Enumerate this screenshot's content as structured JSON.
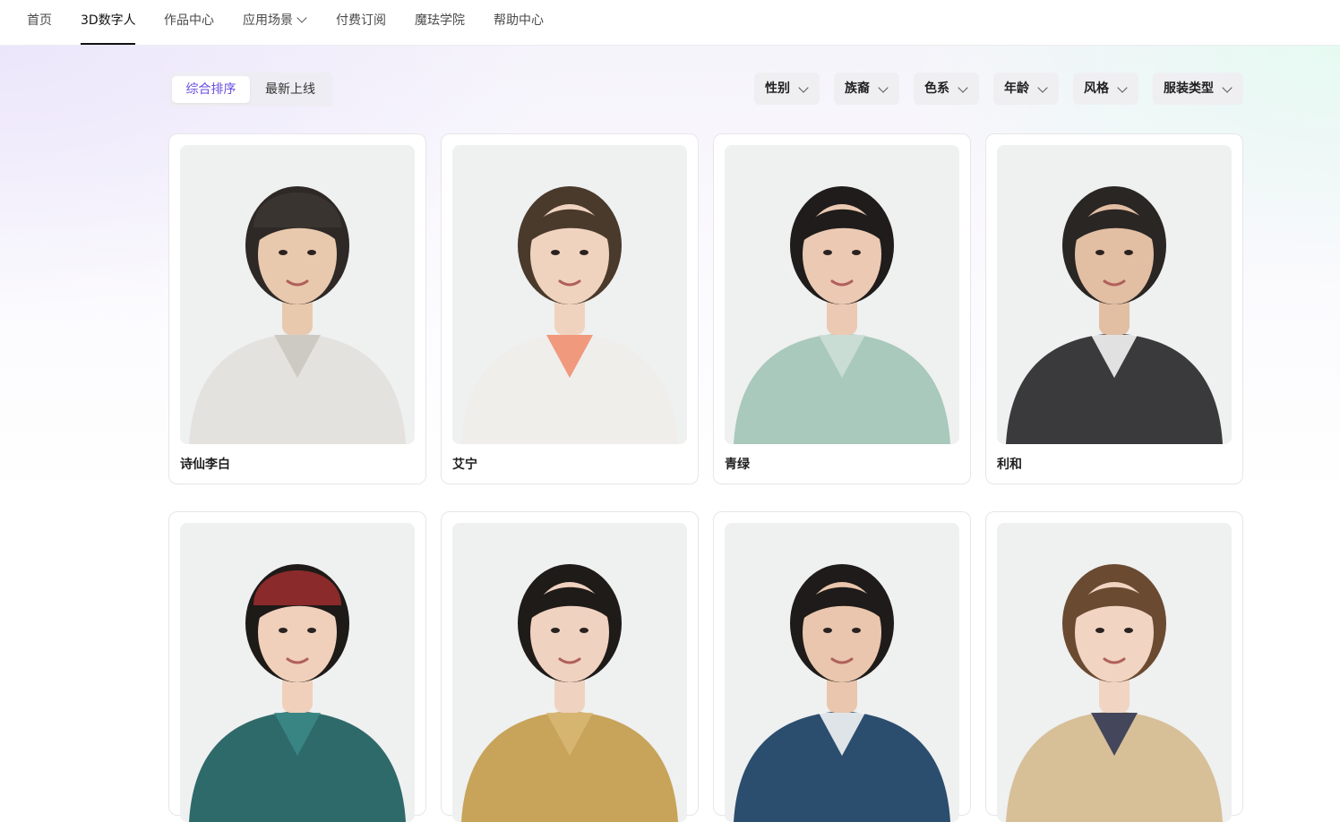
{
  "nav": {
    "items": [
      "首页",
      "3D数字人",
      "作品中心",
      "应用场景",
      "付费订阅",
      "魔珐学院",
      "帮助中心"
    ],
    "active_index": 1,
    "dropdown_item": "应用场景"
  },
  "sort": {
    "options": [
      "综合排序",
      "最新上线"
    ],
    "active": "综合排序"
  },
  "filters": [
    "性别",
    "族裔",
    "色系",
    "年龄",
    "风格",
    "服装类型"
  ],
  "avatars": [
    {
      "name": "诗仙李白",
      "skin": "#e8c9ae",
      "hair": "#2e2926",
      "outfit": "#e4e2de",
      "outfit_accent": "#c9c6c0",
      "hat": "#3a3430"
    },
    {
      "name": "艾宁",
      "skin": "#f0d3bf",
      "hair": "#4a3a2c",
      "outfit": "#efeeea",
      "outfit_accent": "#f08a6a"
    },
    {
      "name": "青绿",
      "skin": "#ecc9b3",
      "hair": "#1f1c1b",
      "outfit": "#a8c9bb",
      "outfit_accent": "#cfe1d8"
    },
    {
      "name": "利和",
      "skin": "#e2bea3",
      "hair": "#2a2624",
      "outfit": "#3a3a3c",
      "outfit_accent": "#ffffff"
    },
    {
      "name": "",
      "skin": "#f0d0bb",
      "hair": "#1e1a18",
      "outfit": "#2f6a6a",
      "outfit_accent": "#3a8a88",
      "hat": "#8a2a2a"
    },
    {
      "name": "",
      "skin": "#f0d2c0",
      "hair": "#1f1b19",
      "outfit": "#c7a45a",
      "outfit_accent": "#d8b874"
    },
    {
      "name": "",
      "skin": "#e9c6ad",
      "hair": "#1e1b1a",
      "outfit": "#2c4e6e",
      "outfit_accent": "#ffffff"
    },
    {
      "name": "",
      "skin": "#f1d4c2",
      "hair": "#6b4a32",
      "outfit": "#d7bf98",
      "outfit_accent": "#2a3050"
    }
  ]
}
